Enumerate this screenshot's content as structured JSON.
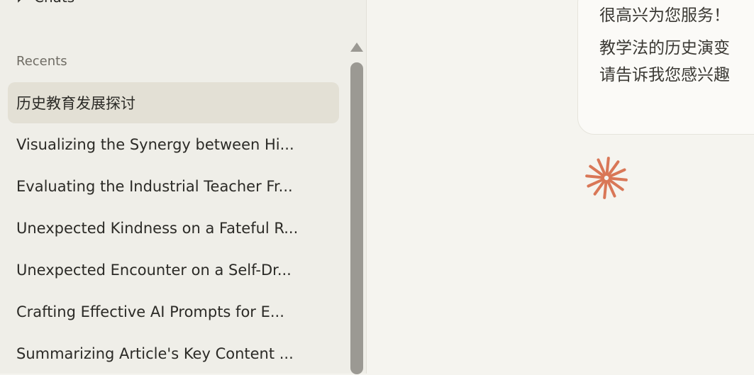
{
  "sidebar": {
    "chats_label": "Chats",
    "recents_heading": "Recents",
    "recents": [
      {
        "label": "历史教育发展探讨",
        "active": true
      },
      {
        "label": "Visualizing the Synergy between Hi..."
      },
      {
        "label": "Evaluating the Industrial Teacher Fr..."
      },
      {
        "label": "Unexpected Kindness on a Fateful R..."
      },
      {
        "label": "Unexpected Encounter on a Self-Dr..."
      },
      {
        "label": "Crafting Effective AI Prompts for E..."
      },
      {
        "label": "Summarizing Article's Key Content ..."
      }
    ]
  },
  "conversation": {
    "assistant_message": {
      "line1": "很高兴为您服务！",
      "line2": "教学法的历史演变",
      "line3": "请告诉我您感兴趣"
    }
  },
  "colors": {
    "accent": "#d97757",
    "sidebar_bg": "#efeee8",
    "main_bg": "#f5f4ef"
  }
}
